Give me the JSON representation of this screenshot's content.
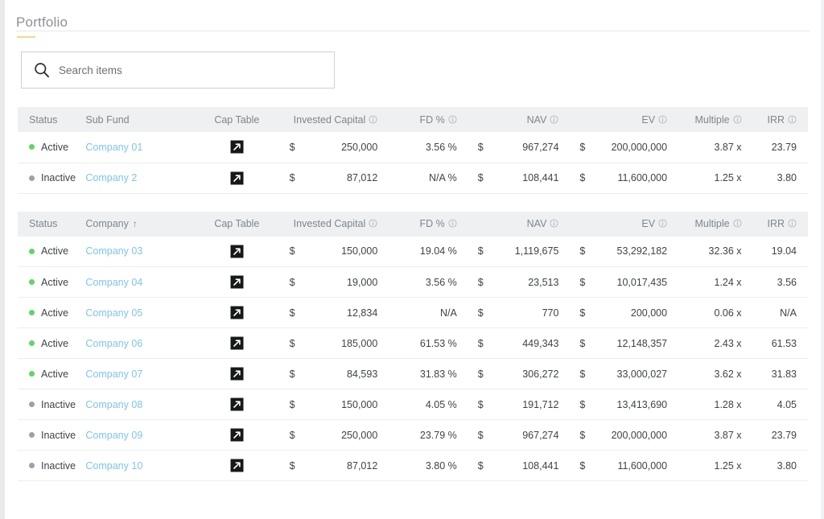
{
  "page": {
    "title": "Portfolio",
    "accent_underline_color": "#f2d98a",
    "title_color": "#8e9196"
  },
  "search": {
    "placeholder": "Search items",
    "value": "",
    "icon": "search-icon"
  },
  "colors": {
    "active_dot": "#5fd75f",
    "inactive_dot": "#9aa3ad",
    "link": "#7ec4ef",
    "header_bg": "#eef0f2",
    "header_text": "#80858b"
  },
  "tables": [
    {
      "id": "sub-fund-table",
      "columns": [
        {
          "key": "status",
          "label": "Status",
          "info": false,
          "sorted": false
        },
        {
          "key": "name",
          "label": "Sub Fund",
          "info": false,
          "sorted": false
        },
        {
          "key": "cap",
          "label": "Cap Table",
          "info": false,
          "sorted": false
        },
        {
          "key": "invested",
          "label": "Invested Capital",
          "info": true,
          "sorted": false
        },
        {
          "key": "fd",
          "label": "FD %",
          "info": true,
          "sorted": false
        },
        {
          "key": "nav",
          "label": "NAV",
          "info": true,
          "sorted": false
        },
        {
          "key": "ev",
          "label": "EV",
          "info": true,
          "sorted": false
        },
        {
          "key": "multiple",
          "label": "Multiple",
          "info": true,
          "sorted": false
        },
        {
          "key": "irr",
          "label": "IRR",
          "info": true,
          "sorted": false
        }
      ],
      "rows": [
        {
          "status": "Active",
          "status_state": "active",
          "name": "Company 01",
          "cap_icon": "external-link-icon",
          "invested_sym": "$",
          "invested": "250,000",
          "fd": "3.56 %",
          "nav_sym": "$",
          "nav": "967,274",
          "ev_sym": "$",
          "ev": "200,000,000",
          "multiple": "3.87 x",
          "irr": "23.79"
        },
        {
          "status": "Inactive",
          "status_state": "inactive",
          "name": "Company 2",
          "cap_icon": "external-link-icon",
          "invested_sym": "$",
          "invested": "87,012",
          "fd": "N/A %",
          "nav_sym": "$",
          "nav": "108,441",
          "ev_sym": "$",
          "ev": "11,600,000",
          "multiple": "1.25 x",
          "irr": "3.80"
        }
      ]
    },
    {
      "id": "company-table",
      "columns": [
        {
          "key": "status",
          "label": "Status",
          "info": false,
          "sorted": false
        },
        {
          "key": "name",
          "label": "Company",
          "info": false,
          "sorted": true,
          "sort_dir": "↑"
        },
        {
          "key": "cap",
          "label": "Cap Table",
          "info": false,
          "sorted": false
        },
        {
          "key": "invested",
          "label": "Invested Capital",
          "info": true,
          "sorted": false
        },
        {
          "key": "fd",
          "label": "FD %",
          "info": true,
          "sorted": false
        },
        {
          "key": "nav",
          "label": "NAV",
          "info": true,
          "sorted": false
        },
        {
          "key": "ev",
          "label": "EV",
          "info": true,
          "sorted": false
        },
        {
          "key": "multiple",
          "label": "Multiple",
          "info": true,
          "sorted": false
        },
        {
          "key": "irr",
          "label": "IRR",
          "info": true,
          "sorted": false
        }
      ],
      "rows": [
        {
          "status": "Active",
          "status_state": "active",
          "name": "Company 03",
          "cap_icon": "external-link-icon",
          "invested_sym": "$",
          "invested": "150,000",
          "fd": "19.04 %",
          "nav_sym": "$",
          "nav": "1,119,675",
          "ev_sym": "$",
          "ev": "53,292,182",
          "multiple": "32.36 x",
          "irr": "19.04"
        },
        {
          "status": "Active",
          "status_state": "active",
          "name": "Company 04",
          "cap_icon": "external-link-icon",
          "invested_sym": "$",
          "invested": "19,000",
          "fd": "3.56 %",
          "nav_sym": "$",
          "nav": "23,513",
          "ev_sym": "$",
          "ev": "10,017,435",
          "multiple": "1.24 x",
          "irr": "3.56"
        },
        {
          "status": "Active",
          "status_state": "active",
          "name": "Company 05",
          "cap_icon": "external-link-icon",
          "invested_sym": "$",
          "invested": "12,834",
          "fd": "N/A",
          "nav_sym": "$",
          "nav": "770",
          "ev_sym": "$",
          "ev": "200,000",
          "multiple": "0.06 x",
          "irr": "N/A"
        },
        {
          "status": "Active",
          "status_state": "active",
          "name": "Company 06",
          "cap_icon": "external-link-icon",
          "invested_sym": "$",
          "invested": "185,000",
          "fd": "61.53 %",
          "nav_sym": "$",
          "nav": "449,343",
          "ev_sym": "$",
          "ev": "12,148,357",
          "multiple": "2.43 x",
          "irr": "61.53"
        },
        {
          "status": "Active",
          "status_state": "active",
          "name": "Company 07",
          "cap_icon": "external-link-icon",
          "invested_sym": "$",
          "invested": "84,593",
          "fd": "31.83 %",
          "nav_sym": "$",
          "nav": "306,272",
          "ev_sym": "$",
          "ev": "33,000,027",
          "multiple": "3.62 x",
          "irr": "31.83"
        },
        {
          "status": "Inactive",
          "status_state": "inactive",
          "name": "Company 08",
          "cap_icon": "external-link-icon",
          "invested_sym": "$",
          "invested": "150,000",
          "fd": "4.05 %",
          "nav_sym": "$",
          "nav": "191,712",
          "ev_sym": "$",
          "ev": "13,413,690",
          "multiple": "1.28 x",
          "irr": "4.05"
        },
        {
          "status": "Inactive",
          "status_state": "inactive",
          "name": "Company 09",
          "cap_icon": "external-link-icon",
          "invested_sym": "$",
          "invested": "250,000",
          "fd": "23.79 %",
          "nav_sym": "$",
          "nav": "967,274",
          "ev_sym": "$",
          "ev": "200,000,000",
          "multiple": "3.87 x",
          "irr": "23.79"
        },
        {
          "status": "Inactive",
          "status_state": "inactive",
          "name": "Company 10",
          "cap_icon": "external-link-icon",
          "invested_sym": "$",
          "invested": "87,012",
          "fd": "3.80 %",
          "nav_sym": "$",
          "nav": "108,441",
          "ev_sym": "$",
          "ev": "11,600,000",
          "multiple": "1.25 x",
          "irr": "3.80"
        }
      ]
    }
  ]
}
